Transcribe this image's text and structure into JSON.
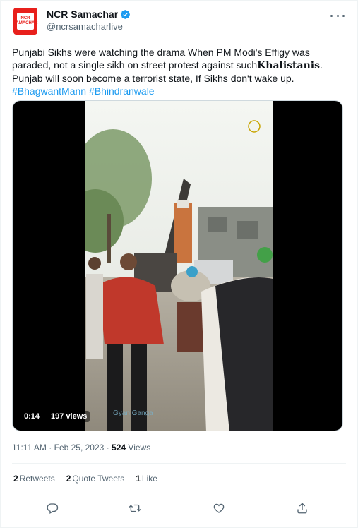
{
  "account": {
    "display_name": "NCR Samachar",
    "handle": "@ncrsamacharlive",
    "avatar_text": [
      "NCR",
      "SAMACHAR"
    ]
  },
  "tweet": {
    "text_part1": "Punjabi Sikhs were watching the drama When PM Modi's Effigy was paraded, not a single sikh on street protest against such",
    "text_bold": "Khalistanis",
    "text_part2": ". Punjab will soon become a terrorist state, If Sikhs don't wake up.",
    "hashtags": [
      "#BhagwantMann",
      "#Bhindranwale"
    ]
  },
  "video": {
    "duration": "0:14",
    "views": "197 views",
    "watermark": "Gyan Ganga"
  },
  "meta": {
    "time": "11:11 AM",
    "date": "Feb 25, 2023",
    "views_count": "524",
    "views_label": "Views"
  },
  "stats": {
    "retweets_count": "2",
    "retweets_label": "Retweets",
    "quotes_count": "2",
    "quotes_label": "Quote Tweets",
    "likes_count": "1",
    "likes_label": "Like"
  },
  "colors": {
    "link": "#1d9bf0",
    "secondary_text": "#536471",
    "avatar_red": "#e8201c"
  },
  "icons": [
    "verified-badge-icon",
    "more-icon",
    "reply-icon",
    "retweet-icon",
    "like-icon",
    "share-icon"
  ]
}
